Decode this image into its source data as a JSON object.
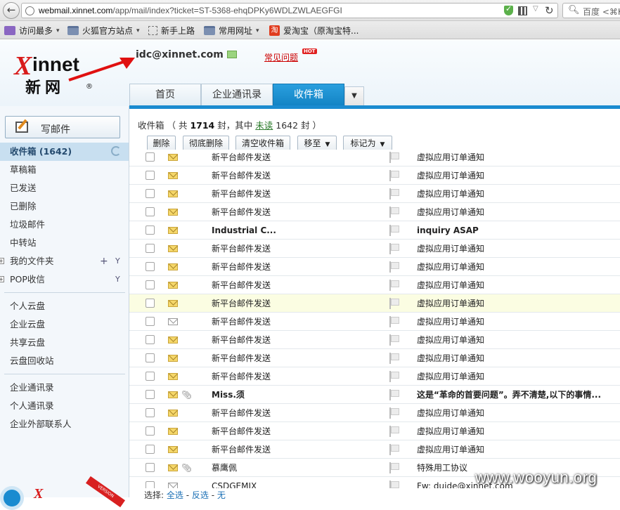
{
  "browser": {
    "url_host": "webmail.xinnet.com",
    "url_path": "/app/mail/index?ticket=ST-5368-ehqDPKy6WDLZWLAEGFGI",
    "search_placeholder": "百度 <⌘K",
    "bookmarks": [
      {
        "label": "访问最多",
        "icon": "visited-icon",
        "dropdown": true
      },
      {
        "label": "火狐官方站点",
        "icon": "folder-icon",
        "dropdown": true
      },
      {
        "label": "新手上路",
        "icon": "dashed-page-icon",
        "dropdown": false
      },
      {
        "label": "常用网址",
        "icon": "folder-icon",
        "dropdown": true
      },
      {
        "label": "爱淘宝（原淘宝特...",
        "icon": "taobao-icon",
        "dropdown": false
      }
    ]
  },
  "header": {
    "logo_x": "X",
    "logo_rest": "innet",
    "logo_cn": "新网",
    "logo_reg": "®",
    "account": "idc@xinnet.com",
    "faq_label": "常见问题",
    "hot_badge": "HOT"
  },
  "tabs": [
    {
      "label": "首页",
      "active": false
    },
    {
      "label": "企业通讯录",
      "active": false
    },
    {
      "label": "收件箱",
      "active": true
    }
  ],
  "sidebar": {
    "compose_label": "写邮件",
    "folders": [
      {
        "label": "收件箱 (1642)",
        "active": true
      },
      {
        "label": "草稿箱"
      },
      {
        "label": "已发送"
      },
      {
        "label": "已删除"
      },
      {
        "label": "垃圾邮件"
      },
      {
        "label": "中转站"
      },
      {
        "label": "我的文件夹"
      },
      {
        "label": "POP收信"
      }
    ],
    "cloud": [
      "个人云盘",
      "企业云盘",
      "共享云盘",
      "云盘回收站"
    ],
    "contacts": [
      "企业通讯录",
      "个人通讯录",
      "企业外部联系人"
    ],
    "promo_x": "X",
    "promo_ribbon": "VERSION"
  },
  "summary": {
    "folder": "收件箱",
    "prefix": "（ 共",
    "total": "1714",
    "mid": "封，其中",
    "unread_label": "未读",
    "unread": "1642",
    "suffix": "封 ）"
  },
  "toolbar": {
    "delete": "删除",
    "perm_delete": "彻底删除",
    "empty": "清空收件箱",
    "move": "移至",
    "mark": "标记为"
  },
  "mails": [
    {
      "sender": "新平台邮件发送",
      "subject": "虚拟应用订单通知",
      "unread": true,
      "attach": false,
      "bold": false
    },
    {
      "sender": "新平台邮件发送",
      "subject": "虚拟应用订单通知",
      "unread": true,
      "attach": false,
      "bold": false
    },
    {
      "sender": "新平台邮件发送",
      "subject": "虚拟应用订单通知",
      "unread": true,
      "attach": false,
      "bold": false
    },
    {
      "sender": "新平台邮件发送",
      "subject": "虚拟应用订单通知",
      "unread": true,
      "attach": false,
      "bold": false
    },
    {
      "sender": "Industrial C...",
      "subject": "inquiry ASAP",
      "unread": true,
      "attach": false,
      "bold": true
    },
    {
      "sender": "新平台邮件发送",
      "subject": "虚拟应用订单通知",
      "unread": true,
      "attach": false,
      "bold": false
    },
    {
      "sender": "新平台邮件发送",
      "subject": "虚拟应用订单通知",
      "unread": true,
      "attach": false,
      "bold": false
    },
    {
      "sender": "新平台邮件发送",
      "subject": "虚拟应用订单通知",
      "unread": true,
      "attach": false,
      "bold": false
    },
    {
      "sender": "新平台邮件发送",
      "subject": "虚拟应用订单通知",
      "unread": true,
      "attach": false,
      "bold": false,
      "highlight": true
    },
    {
      "sender": "新平台邮件发送",
      "subject": "虚拟应用订单通知",
      "unread": false,
      "attach": false,
      "bold": false
    },
    {
      "sender": "新平台邮件发送",
      "subject": "虚拟应用订单通知",
      "unread": true,
      "attach": false,
      "bold": false
    },
    {
      "sender": "新平台邮件发送",
      "subject": "虚拟应用订单通知",
      "unread": true,
      "attach": false,
      "bold": false
    },
    {
      "sender": "新平台邮件发送",
      "subject": "虚拟应用订单通知",
      "unread": true,
      "attach": false,
      "bold": false
    },
    {
      "sender": "Miss.须",
      "subject": "这是“革命的首要问题”。弄不清楚,以下的事情...",
      "unread": true,
      "attach": true,
      "bold": true
    },
    {
      "sender": "新平台邮件发送",
      "subject": "虚拟应用订单通知",
      "unread": true,
      "attach": false,
      "bold": false
    },
    {
      "sender": "新平台邮件发送",
      "subject": "虚拟应用订单通知",
      "unread": true,
      "attach": false,
      "bold": false
    },
    {
      "sender": "新平台邮件发送",
      "subject": "虚拟应用订单通知",
      "unread": true,
      "attach": false,
      "bold": false
    },
    {
      "sender": "慕鹰佩",
      "subject": "特殊用工协议",
      "unread": true,
      "attach": true,
      "bold": false
    },
    {
      "sender": "CSDGEMIX",
      "subject": "Fw: duide@xinnet.com",
      "unread": false,
      "attach": false,
      "bold": false
    }
  ],
  "select_bar": {
    "label": "选择:",
    "all": "全选",
    "sep1": "-",
    "invert": "反选",
    "sep2": "-",
    "none": "无"
  },
  "watermark": "www.wooyun.org"
}
